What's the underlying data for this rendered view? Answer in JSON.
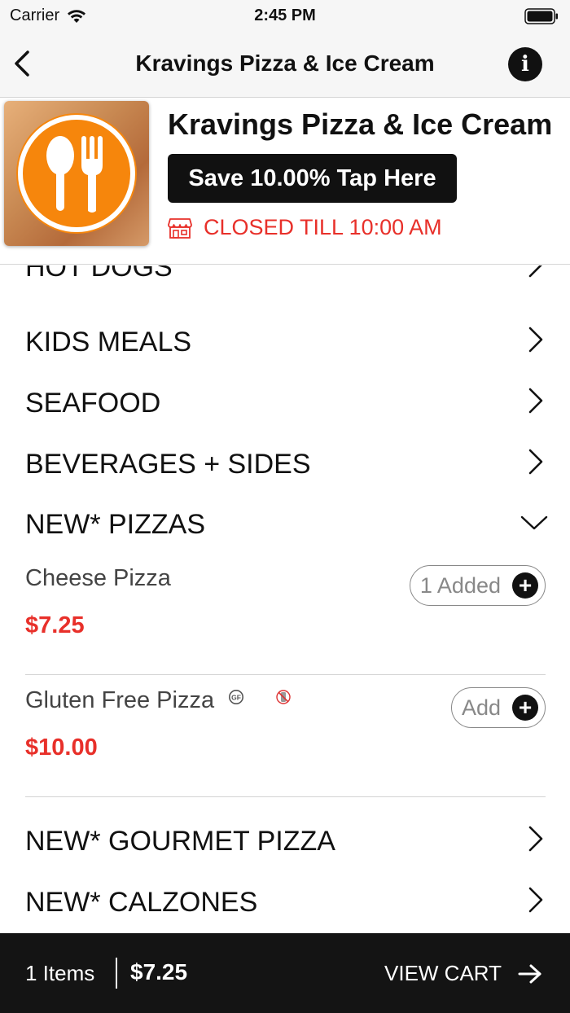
{
  "status_bar": {
    "carrier": "Carrier",
    "time": "2:45 PM"
  },
  "nav": {
    "title": "Kravings Pizza & Ice Cream",
    "info_glyph": "i"
  },
  "restaurant": {
    "name": "Kravings Pizza & Ice Cream",
    "promo_label": "Save 10.00% Tap Here",
    "status_text": "CLOSED TILL 10:00 AM",
    "status_color": "#e8302a",
    "logo_color": "#f6860c"
  },
  "menu": {
    "categories_top": [
      {
        "label": "HOT DOGS",
        "icon": "chevron-right-icon"
      },
      {
        "label": "KIDS MEALS",
        "icon": "chevron-right-icon"
      },
      {
        "label": "SEAFOOD",
        "icon": "chevron-right-icon"
      },
      {
        "label": "BEVERAGES + SIDES",
        "icon": "chevron-right-icon"
      }
    ],
    "expanded_category": {
      "label": "NEW* PIZZAS",
      "icon": "chevron-down-icon"
    },
    "items": [
      {
        "name": "Cheese Pizza",
        "price": "$7.25",
        "button_label": "1 Added",
        "badges": []
      },
      {
        "name": "Gluten Free Pizza",
        "price": "$10.00",
        "button_label": "Add",
        "badges": [
          "gluten-free-icon",
          "no-dairy-icon"
        ]
      }
    ],
    "categories_bottom": [
      {
        "label": "NEW* GOURMET PIZZA",
        "icon": "chevron-right-icon"
      },
      {
        "label": "NEW* CALZONES",
        "icon": "chevron-right-icon"
      }
    ]
  },
  "cart": {
    "items_label": "1 Items",
    "total": "$7.25",
    "view_label": "VIEW CART"
  },
  "colors": {
    "accent_red": "#e8302a",
    "cart_bar": "#141414",
    "nav_bg": "#f6f6f6"
  }
}
